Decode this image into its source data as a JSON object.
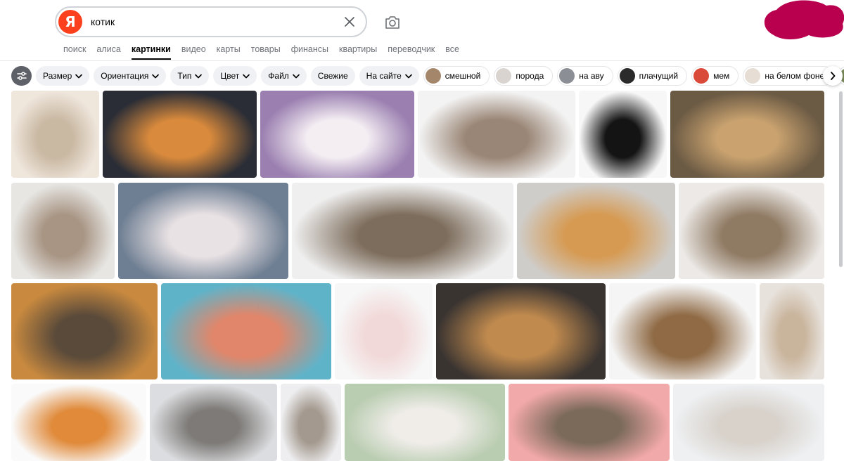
{
  "search": {
    "logo_letter": "Я",
    "query": "котик",
    "placeholder": ""
  },
  "tabs": [
    {
      "label": "поиск",
      "active": false
    },
    {
      "label": "алиса",
      "active": false
    },
    {
      "label": "картинки",
      "active": true
    },
    {
      "label": "видео",
      "active": false
    },
    {
      "label": "карты",
      "active": false
    },
    {
      "label": "товары",
      "active": false
    },
    {
      "label": "финансы",
      "active": false
    },
    {
      "label": "квартиры",
      "active": false
    },
    {
      "label": "переводчик",
      "active": false
    },
    {
      "label": "все",
      "active": false
    }
  ],
  "filters": [
    {
      "label": "Размер",
      "dropdown": true
    },
    {
      "label": "Ориентация",
      "dropdown": true
    },
    {
      "label": "Тип",
      "dropdown": true
    },
    {
      "label": "Цвет",
      "dropdown": true
    },
    {
      "label": "Файл",
      "dropdown": true
    },
    {
      "label": "Свежие",
      "dropdown": false
    },
    {
      "label": "На сайте",
      "dropdown": true
    }
  ],
  "suggestions": [
    {
      "label": "смешной",
      "color": "#a4876a"
    },
    {
      "label": "порода",
      "color": "#d9d4cf"
    },
    {
      "label": "на аву",
      "color": "#8b8f95"
    },
    {
      "label": "плачущий",
      "color": "#2b2b2b"
    },
    {
      "label": "мем",
      "color": "#d94a3a"
    },
    {
      "label": "на белом фоне",
      "color": "#e6ddd4"
    }
  ],
  "colors": {
    "brand": "#fc3f1d",
    "chip_bg": "#f0f1f4",
    "settings_bg": "#5e6167"
  },
  "images": [
    {
      "name": "image-cartoon-kitten-white",
      "c1": "#efe6dc",
      "c2": "#c9b8a2"
    },
    {
      "name": "image-ginger-kitten-dark-bg",
      "c1": "#2a2d36",
      "c2": "#d98a3c"
    },
    {
      "name": "image-fluffy-white-creature",
      "c1": "#9a7fb0",
      "c2": "#f4eef3"
    },
    {
      "name": "image-tabby-kitten-lying",
      "c1": "#f3f3f3",
      "c2": "#9a8676"
    },
    {
      "name": "image-black-kitten",
      "c1": "#f7f7f7",
      "c2": "#141414"
    },
    {
      "name": "image-tabby-kitten-sunny",
      "c1": "#6b5a44",
      "c2": "#c9a26f"
    },
    {
      "name": "image-kitten-white-basket",
      "c1": "#e7e6e3",
      "c2": "#a89584"
    },
    {
      "name": "image-white-persian-window",
      "c1": "#6f7f93",
      "c2": "#e9e2e4"
    },
    {
      "name": "image-tabby-sleeping-blanket",
      "c1": "#efefef",
      "c2": "#7d6d5c"
    },
    {
      "name": "image-ginger-cat-armchair",
      "c1": "#cfcdca",
      "c2": "#d69a52"
    },
    {
      "name": "image-tabby-curled-sleeping",
      "c1": "#ece9e6",
      "c2": "#8f7a63"
    },
    {
      "name": "image-cat-smartphone",
      "c1": "#c98a3f",
      "c2": "#5a4a3a"
    },
    {
      "name": "image-kitten-yarn-ball",
      "c1": "#5fb3c9",
      "c2": "#e1866a"
    },
    {
      "name": "image-cartoon-white-cat",
      "c1": "#f7f7f7",
      "c2": "#f2d9d9"
    },
    {
      "name": "image-tabby-kitten-blanket",
      "c1": "#3a3431",
      "c2": "#c08a4e"
    },
    {
      "name": "image-smiling-tabby-cat",
      "c1": "#f5f5f5",
      "c2": "#8f6a45"
    },
    {
      "name": "image-kitten-sofa-bright",
      "c1": "#e7e2dc",
      "c2": "#c9b49c"
    },
    {
      "name": "image-ginger-kitten-surprised",
      "c1": "#fafafa",
      "c2": "#e08a3a"
    },
    {
      "name": "image-kitten-window-sill",
      "c1": "#dcdde0",
      "c2": "#7d7a77"
    },
    {
      "name": "image-kitten-white-sheets",
      "c1": "#eeeef0",
      "c2": "#a3998e"
    },
    {
      "name": "image-white-kitten-plants",
      "c1": "#b9cdb1",
      "c2": "#f0ede9"
    },
    {
      "name": "image-kitten-red-heart",
      "c1": "#f2a9a9",
      "c2": "#7b6a5a"
    },
    {
      "name": "image-two-white-kittens-snow",
      "c1": "#eef0f2",
      "c2": "#d8d2cb"
    }
  ]
}
